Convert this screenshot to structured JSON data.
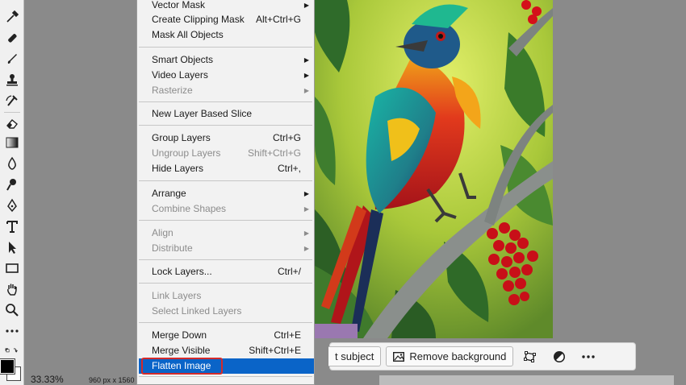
{
  "menu": {
    "items": [
      {
        "label": "Vector Mask",
        "shortcut": "",
        "submenu": true,
        "disabled": false
      },
      {
        "label": "Create Clipping Mask",
        "shortcut": "Alt+Ctrl+G",
        "submenu": false,
        "disabled": false
      },
      {
        "label": "Mask All Objects",
        "shortcut": "",
        "submenu": false,
        "disabled": false
      },
      {
        "label": "Smart Objects",
        "shortcut": "",
        "submenu": true,
        "disabled": false
      },
      {
        "label": "Video Layers",
        "shortcut": "",
        "submenu": true,
        "disabled": false
      },
      {
        "label": "Rasterize",
        "shortcut": "",
        "submenu": true,
        "disabled": true
      },
      {
        "label": "New Layer Based Slice",
        "shortcut": "",
        "submenu": false,
        "disabled": false
      },
      {
        "label": "Group Layers",
        "shortcut": "Ctrl+G",
        "submenu": false,
        "disabled": false
      },
      {
        "label": "Ungroup Layers",
        "shortcut": "Shift+Ctrl+G",
        "submenu": false,
        "disabled": true
      },
      {
        "label": "Hide Layers",
        "shortcut": "Ctrl+,",
        "submenu": false,
        "disabled": false
      },
      {
        "label": "Arrange",
        "shortcut": "",
        "submenu": true,
        "disabled": false
      },
      {
        "label": "Combine Shapes",
        "shortcut": "",
        "submenu": true,
        "disabled": true
      },
      {
        "label": "Align",
        "shortcut": "",
        "submenu": true,
        "disabled": true
      },
      {
        "label": "Distribute",
        "shortcut": "",
        "submenu": true,
        "disabled": true
      },
      {
        "label": "Lock Layers...",
        "shortcut": "Ctrl+/",
        "submenu": false,
        "disabled": false
      },
      {
        "label": "Link Layers",
        "shortcut": "",
        "submenu": false,
        "disabled": true
      },
      {
        "label": "Select Linked Layers",
        "shortcut": "",
        "submenu": false,
        "disabled": true
      },
      {
        "label": "Merge Down",
        "shortcut": "Ctrl+E",
        "submenu": false,
        "disabled": false
      },
      {
        "label": "Merge Visible",
        "shortcut": "Shift+Ctrl+E",
        "submenu": false,
        "disabled": false
      },
      {
        "label": "Flatten Image",
        "shortcut": "",
        "submenu": false,
        "disabled": false,
        "highlighted": true
      }
    ]
  },
  "taskbar": {
    "select_subject_label": "t subject",
    "remove_background_label": "Remove background"
  },
  "status": {
    "zoom": "33.33%",
    "doc_size": "960 px x 1560"
  },
  "colors": {
    "menu_highlight": "#0a64c8",
    "annotation_box": "#d42a2a"
  },
  "icons": [
    "eyedropper-icon",
    "healing-brush-icon",
    "brush-icon",
    "clone-stamp-icon",
    "history-brush-icon",
    "eraser-icon",
    "gradient-icon",
    "blur-icon",
    "dodge-icon",
    "pen-icon",
    "type-icon",
    "path-selection-icon",
    "rectangle-icon",
    "hand-icon",
    "zoom-icon",
    "more-tools-icon"
  ]
}
